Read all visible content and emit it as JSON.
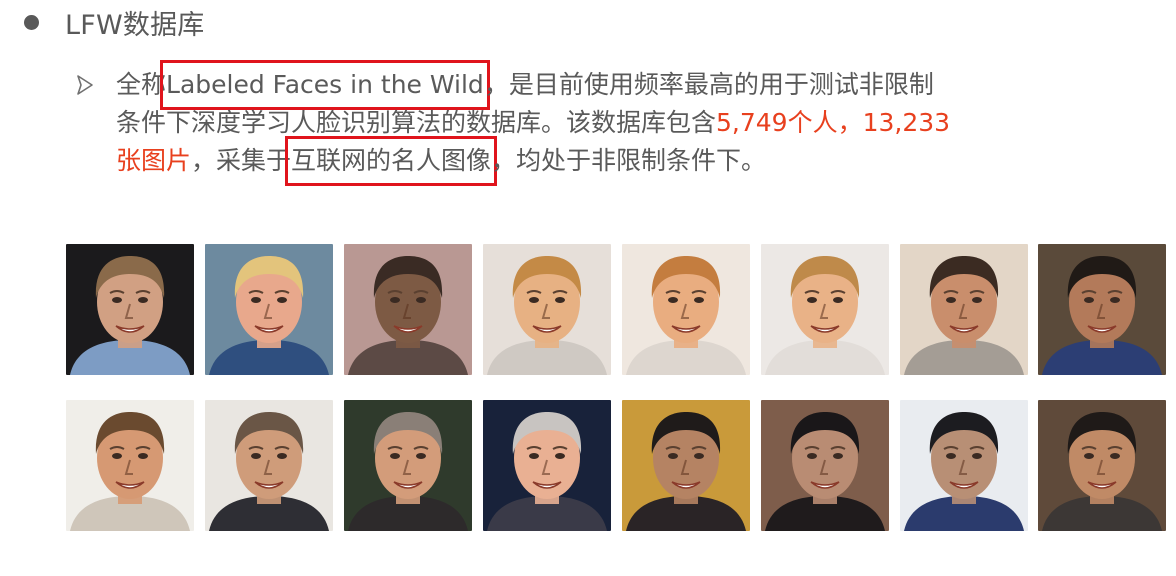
{
  "slide": {
    "title": "LFW数据库",
    "para": {
      "l1_a": "全称",
      "l1_boxed": "Labeled Faces in the Wild",
      "l1_b": "，是目前使用频率最高的用于测试非限制",
      "l2_a": "条件下深度学习人脸识别算法的数据库。该数据库包含",
      "l2_red": "5,749个人，13,233",
      "l3_red": "张图片",
      "l3_a": "，采集于",
      "l3_boxed": "互联网的名人图像",
      "l3_b": "，均处于非限制条件下。"
    },
    "colors": {
      "text": "#5a5a5a",
      "highlight": "#e8401e",
      "box": "#e0141c"
    },
    "icons": {
      "title_bullet": "filled-circle-icon",
      "sub_bullet": "arrow-bullet-icon"
    },
    "faces": [
      {
        "bg": "#1b1a1c",
        "skin": "#d1a083",
        "hair": "#8a6a4a",
        "shirt": "#7d9cc4"
      },
      {
        "bg": "#6d8a9f",
        "skin": "#e8a88c",
        "hair": "#e3c47c",
        "shirt": "#2f4f7f"
      },
      {
        "bg": "#b99893",
        "skin": "#7d5a44",
        "hair": "#3a2b24",
        "shirt": "#5c4a45"
      },
      {
        "bg": "#e6dfd9",
        "skin": "#e7b183",
        "hair": "#c48a46",
        "shirt": "#cfc9c3"
      },
      {
        "bg": "#efe7df",
        "skin": "#e9ad80",
        "hair": "#c47d3f",
        "shirt": "#ddd6cf"
      },
      {
        "bg": "#ece8e5",
        "skin": "#e9b287",
        "hair": "#bf8a4a",
        "shirt": "#e2ddd9"
      },
      {
        "bg": "#e3d6c7",
        "skin": "#c98e6c",
        "hair": "#3b2b22",
        "shirt": "#a49d95"
      },
      {
        "bg": "#5a4a3a",
        "skin": "#b37a5a",
        "hair": "#201a16",
        "shirt": "#2c3e74"
      },
      {
        "bg": "#f0eee9",
        "skin": "#d69973",
        "hair": "#6a4a2f",
        "shirt": "#cfc6ba"
      },
      {
        "bg": "#e9e6e1",
        "skin": "#cf9c7a",
        "hair": "#6a5646",
        "shirt": "#2e2e34"
      },
      {
        "bg": "#2f3a2c",
        "skin": "#d39c7a",
        "hair": "#8a7f77",
        "shirt": "#2d2a2b"
      },
      {
        "bg": "#18223a",
        "skin": "#e9b093",
        "hair": "#c8c4c1",
        "shirt": "#3a3a48"
      },
      {
        "bg": "#c99a3a",
        "skin": "#b58363",
        "hair": "#1f1b1a",
        "shirt": "#2a2426"
      },
      {
        "bg": "#7e5d4b",
        "skin": "#b98c73",
        "hair": "#1a1719",
        "shirt": "#1f1b1c"
      },
      {
        "bg": "#e9ecf0",
        "skin": "#b88f75",
        "hair": "#1c1c20",
        "shirt": "#2b3b6d"
      },
      {
        "bg": "#5f4a3a",
        "skin": "#c08a66",
        "hair": "#1f1a18",
        "shirt": "#3c3735"
      }
    ]
  }
}
